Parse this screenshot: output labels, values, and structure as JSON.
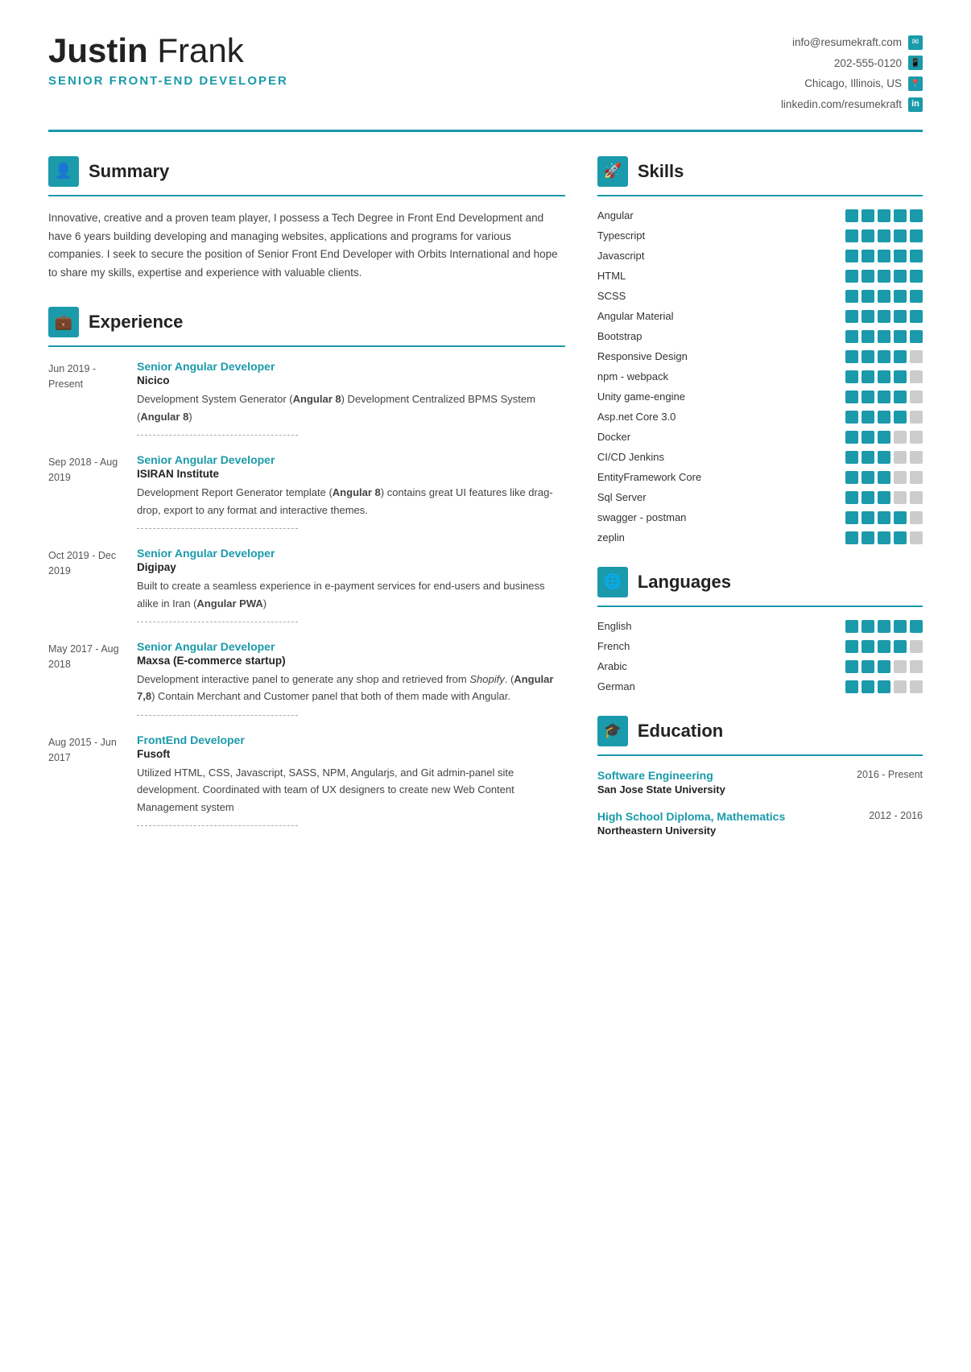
{
  "header": {
    "first_name": "Justin",
    "last_name": "Frank",
    "title": "SENIOR FRONT-END DEVELOPER",
    "contact": {
      "email": "info@resumekraft.com",
      "phone": "202-555-0120",
      "location": "Chicago, Illinois, US",
      "linkedin": "linkedin.com/resumekraft"
    }
  },
  "summary": {
    "section_title": "Summary",
    "text": "Innovative, creative and a proven team player, I possess a Tech Degree in Front End Development and have 6 years building developing and managing websites, applications and programs for various companies. I seek to secure the position of Senior Front End Developer with Orbits International and hope to share my skills, expertise and experience with valuable clients."
  },
  "experience": {
    "section_title": "Experience",
    "items": [
      {
        "date": "Jun 2019 - Present",
        "title": "Senior Angular Developer",
        "company": "Nicico",
        "desc": "Development System Generator (Angular 8) Development Centralized BPMS System (Angular 8)"
      },
      {
        "date": "Sep 2018 - Aug 2019",
        "title": "Senior Angular Developer",
        "company": "ISIRAN Institute",
        "desc": "Development Report Generator template (Angular 8) contains great UI features like drag-drop, export to any format and interactive themes."
      },
      {
        "date": "Oct 2019 - Dec 2019",
        "title": "Senior Angular Developer",
        "company": "Digipay",
        "desc": "Built to create a seamless experience in e-payment services for end-users and business alike in Iran (Angular PWA)"
      },
      {
        "date": "May 2017 - Aug 2018",
        "title": "Senior Angular Developer",
        "company": "Maxsa (E-commerce startup)",
        "desc": "Development interactive panel to generate any shop and retrieved from Shopify. (Angular 7,8) Contain Merchant and Customer panel that both of them made with Angular."
      },
      {
        "date": "Aug 2015 - Jun 2017",
        "title": "FrontEnd Developer",
        "company": "Fusoft",
        "desc": "Utilized HTML, CSS, Javascript, SASS, NPM, Angularjs, and Git admin-panel site development. Coordinated with team of UX designers to create new Web Content Management system"
      }
    ]
  },
  "skills": {
    "section_title": "Skills",
    "items": [
      {
        "name": "Angular",
        "filled": 5,
        "total": 5
      },
      {
        "name": "Typescript",
        "filled": 5,
        "total": 5
      },
      {
        "name": "Javascript",
        "filled": 5,
        "total": 5
      },
      {
        "name": "HTML",
        "filled": 5,
        "total": 5
      },
      {
        "name": "SCSS",
        "filled": 5,
        "total": 5
      },
      {
        "name": "Angular Material",
        "filled": 5,
        "total": 5
      },
      {
        "name": "Bootstrap",
        "filled": 5,
        "total": 5
      },
      {
        "name": "Responsive Design",
        "filled": 4,
        "total": 5
      },
      {
        "name": "npm - webpack",
        "filled": 4,
        "total": 5
      },
      {
        "name": "Unity game-engine",
        "filled": 4,
        "total": 5
      },
      {
        "name": "Asp.net Core 3.0",
        "filled": 4,
        "total": 5
      },
      {
        "name": "Docker",
        "filled": 3,
        "total": 5
      },
      {
        "name": "CI/CD Jenkins",
        "filled": 3,
        "total": 5
      },
      {
        "name": "EntityFramework Core",
        "filled": 3,
        "total": 5
      },
      {
        "name": "Sql Server",
        "filled": 3,
        "total": 5
      },
      {
        "name": "swagger - postman",
        "filled": 4,
        "total": 5
      },
      {
        "name": "zeplin",
        "filled": 4,
        "total": 5
      }
    ]
  },
  "languages": {
    "section_title": "Languages",
    "items": [
      {
        "name": "English",
        "filled": 5,
        "total": 5
      },
      {
        "name": "French",
        "filled": 4,
        "total": 5
      },
      {
        "name": "Arabic",
        "filled": 3,
        "total": 5
      },
      {
        "name": "German",
        "filled": 3,
        "total": 5
      }
    ]
  },
  "education": {
    "section_title": "Education",
    "items": [
      {
        "degree": "Software Engineering",
        "school": "San Jose State University",
        "date": "2016 - Present"
      },
      {
        "degree": "High School Diploma, Mathematics",
        "school": "Northeastern University",
        "date": "2012 - 2016"
      }
    ]
  },
  "icons": {
    "person": "&#128100;",
    "briefcase": "&#128188;",
    "rocket": "&#128640;",
    "globe": "&#127760;",
    "graduation": "&#127891;",
    "email": "&#9993;",
    "phone": "&#128241;",
    "location": "&#128205;",
    "linkedin": "in"
  }
}
